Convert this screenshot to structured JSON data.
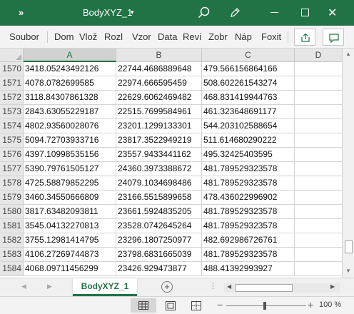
{
  "titlebar": {
    "more": "»",
    "title": "BodyXYZ_1",
    "title_chevron": "▾",
    "icons": [
      "search-icon",
      "pen-icon",
      "minimize-icon",
      "maximize-icon",
      "close-icon"
    ],
    "close": "✕",
    "accent": "#217346"
  },
  "ribbon": {
    "tabs": [
      "Soubor",
      "Dom",
      "Vlož",
      "Rozl",
      "Vzor",
      "Data",
      "Revi",
      "Zobr",
      "Náp",
      "Foxit"
    ],
    "icons": [
      "share-icon",
      "comment-icon"
    ]
  },
  "grid": {
    "columns": [
      "A",
      "B",
      "C",
      "D"
    ],
    "selected_column": "A",
    "rows": [
      {
        "num": "1570",
        "a": "3418.05243492126",
        "b": "22744.4686889648",
        "c": "479.566156864166"
      },
      {
        "num": "1571",
        "a": "4078.0782699585",
        "b": "22974.666595459",
        "c": "508.602261543274"
      },
      {
        "num": "1572",
        "a": "3118.84307861328",
        "b": "22629.6062469482",
        "c": "468.831419944763"
      },
      {
        "num": "1573",
        "a": "2843.63055229187",
        "b": "22515.7699584961",
        "c": "461.323648691177"
      },
      {
        "num": "1574",
        "a": "4802.93560028076",
        "b": "23201.1299133301",
        "c": "544.203102588654"
      },
      {
        "num": "1575",
        "a": "5094.72703933716",
        "b": "23817.3522949219",
        "c": "511.614680290222"
      },
      {
        "num": "1576",
        "a": "4397.10998535156",
        "b": "23557.9433441162",
        "c": "495.32425403595"
      },
      {
        "num": "1577",
        "a": "5390.79761505127",
        "b": "24360.3973388672",
        "c": "481.789529323578"
      },
      {
        "num": "1578",
        "a": "4725.58879852295",
        "b": "24079.1034698486",
        "c": "481.789529323578"
      },
      {
        "num": "1579",
        "a": "3460.34550666809",
        "b": "23166.5515899658",
        "c": "478.436022996902"
      },
      {
        "num": "1580",
        "a": "3817.63482093811",
        "b": "23661.5924835205",
        "c": "481.789529323578"
      },
      {
        "num": "1581",
        "a": "3545.04132270813",
        "b": "23528.0742645264",
        "c": "481.789529323578"
      },
      {
        "num": "1582",
        "a": "3755.12981414795",
        "b": "23296.1807250977",
        "c": "482.692986726761"
      },
      {
        "num": "1583",
        "a": "4106.27269744873",
        "b": "23798.6831665039",
        "c": "481.789529323578"
      },
      {
        "num": "1584",
        "a": "4068.09711456299",
        "b": "23426.929473877",
        "c": "488.41392993927"
      }
    ]
  },
  "sheets": {
    "nav_prev": "◀",
    "nav_next": "▶",
    "active": "BodyXYZ_1",
    "add": "+",
    "dots": "⋮",
    "scroll_left": "◀",
    "scroll_right": "▶"
  },
  "status": {
    "zoom_minus": "−",
    "zoom_plus": "+",
    "zoom": "100 %",
    "zoom_fraction": 0.46,
    "icons": [
      "normal-view-icon",
      "page-layout-icon",
      "page-break-icon"
    ]
  },
  "vscroll": {
    "up": "▲",
    "down": "▼",
    "position_fraction": 0.95
  }
}
